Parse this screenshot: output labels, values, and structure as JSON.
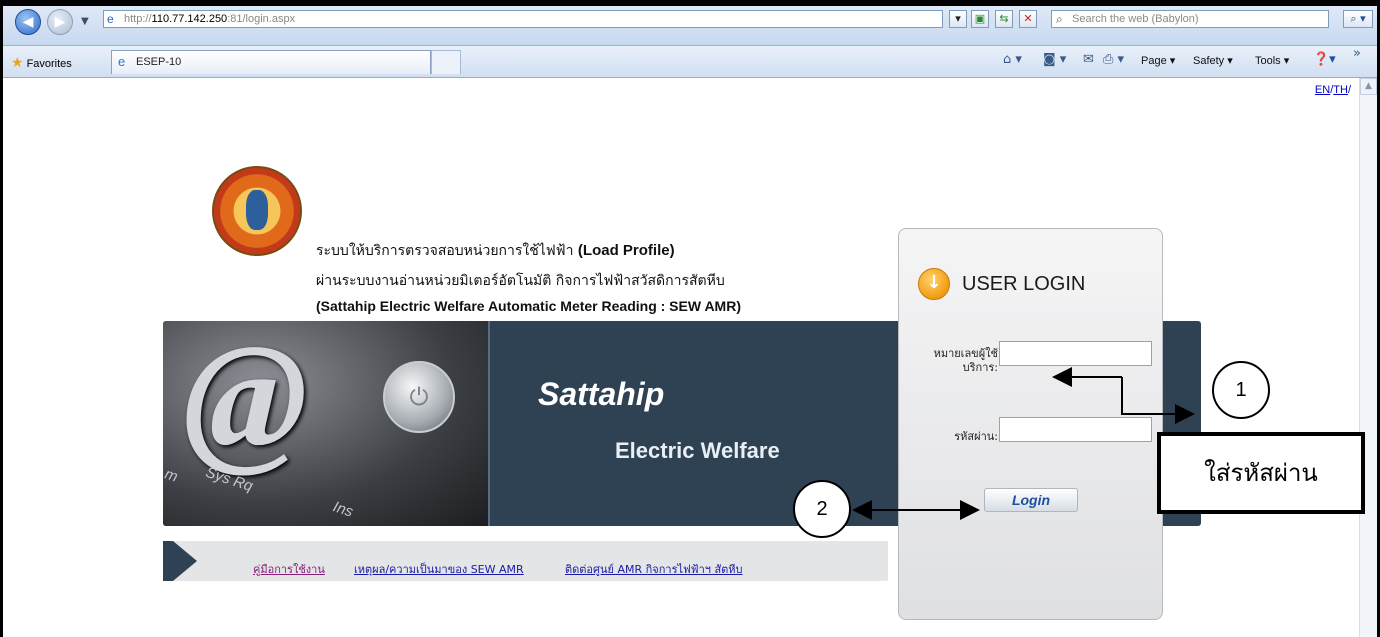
{
  "browser": {
    "url_prefix": "http://",
    "url_host": "110.77.142.250",
    "url_rest": ":81/login.aspx",
    "search_placeholder": "Search the web (Babylon)",
    "favorites_label": "Favorites",
    "tab_title": "ESEP-10",
    "command_bar": {
      "page": "Page ▾",
      "safety": "Safety ▾",
      "tools": "Tools ▾"
    }
  },
  "lang": {
    "en": "EN",
    "sep": "/",
    "th": "TH",
    "sep2": "/"
  },
  "header": {
    "line1_th": "ระบบให้บริการตรวจสอบหน่วยการใช้ไฟฟ้า ",
    "line1_en": "(Load Profile)",
    "line2": "ผ่านระบบงานอ่านหน่วยมิเตอร์อัตโนมัติ กิจการไฟฟ้าสวัสดิการสัตหีบ",
    "line3": "(Sattahip Electric Welfare Automatic Meter Reading : SEW AMR)"
  },
  "banner": {
    "title": "Sattahip",
    "subtitle": "Electric Welfare",
    "keys": [
      "Sys Rq",
      "Ins",
      "m"
    ]
  },
  "links": [
    "คู่มือการใช้งาน",
    "เหตุผล/ความเป็นมาของ SEW AMR",
    "ติดต่อศูนย์ AMR กิจการไฟฟ้าฯ สัตหีบ"
  ],
  "login": {
    "title": "USER LOGIN",
    "user_label_1": "หมายเลขผู้ใช้",
    "user_label_2": "บริการ:",
    "user_value": "",
    "password_label": "รหัสผ่าน:",
    "password_value": "",
    "button": "Login"
  },
  "annotations": {
    "marker1": "1",
    "marker2": "2",
    "callout": "ใส่รหัสผ่าน"
  }
}
